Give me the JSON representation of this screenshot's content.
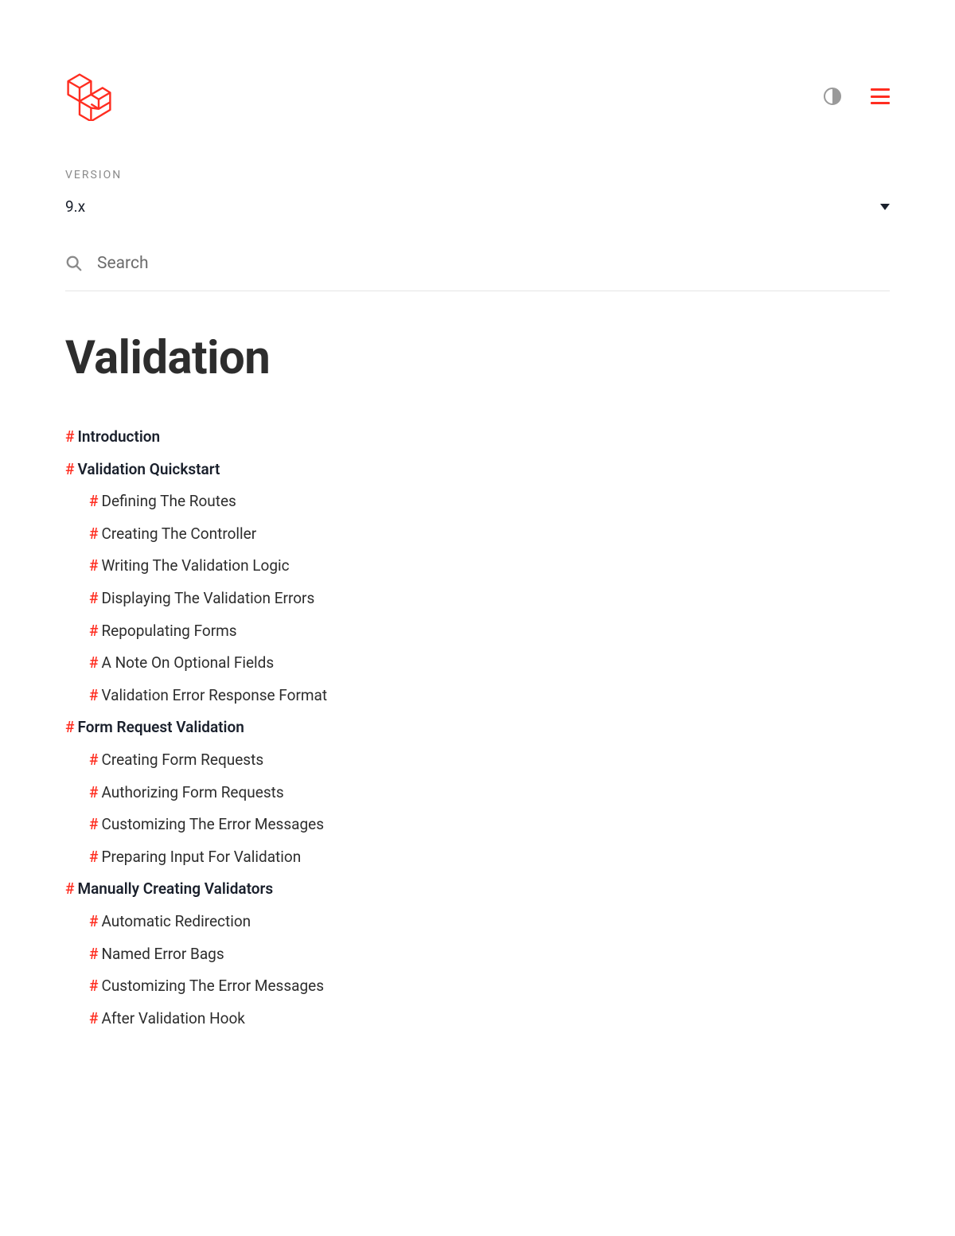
{
  "version": {
    "label": "VERSION",
    "value": "9.x"
  },
  "search": {
    "placeholder": "Search"
  },
  "page": {
    "title": "Validation"
  },
  "toc": [
    {
      "label": "Introduction",
      "level": 0
    },
    {
      "label": "Validation Quickstart",
      "level": 0
    },
    {
      "label": "Defining The Routes",
      "level": 1
    },
    {
      "label": "Creating The Controller",
      "level": 1
    },
    {
      "label": "Writing The Validation Logic",
      "level": 1
    },
    {
      "label": "Displaying The Validation Errors",
      "level": 1
    },
    {
      "label": "Repopulating Forms",
      "level": 1
    },
    {
      "label": "A Note On Optional Fields",
      "level": 1
    },
    {
      "label": "Validation Error Response Format",
      "level": 1
    },
    {
      "label": "Form Request Validation",
      "level": 0
    },
    {
      "label": "Creating Form Requests",
      "level": 1
    },
    {
      "label": "Authorizing Form Requests",
      "level": 1
    },
    {
      "label": "Customizing The Error Messages",
      "level": 1
    },
    {
      "label": "Preparing Input For Validation",
      "level": 1
    },
    {
      "label": "Manually Creating Validators",
      "level": 0
    },
    {
      "label": "Automatic Redirection",
      "level": 1
    },
    {
      "label": "Named Error Bags",
      "level": 1
    },
    {
      "label": "Customizing The Error Messages",
      "level": 1
    },
    {
      "label": "After Validation Hook",
      "level": 1
    }
  ]
}
